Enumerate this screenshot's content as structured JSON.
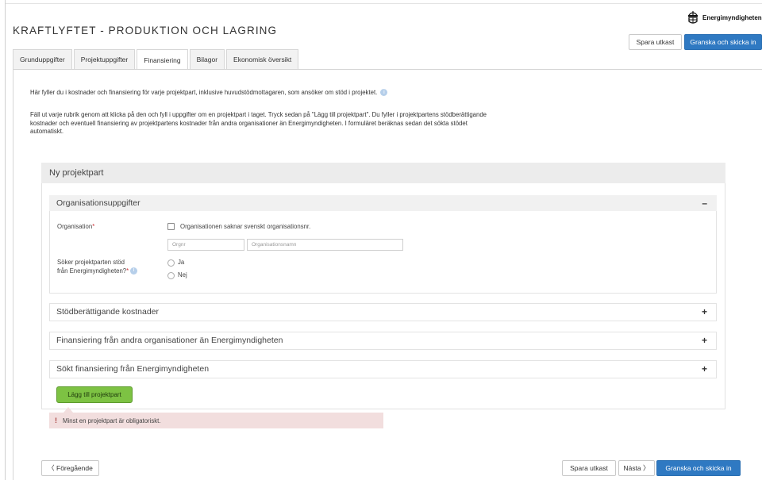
{
  "app": {
    "title": "KRAFTLYFTET - PRODUKTION OCH LAGRING",
    "logo_text": "Energimyndigheten"
  },
  "header_actions": {
    "save_draft": "Spara utkast",
    "review_submit": "Granska och skicka in"
  },
  "tabs": [
    {
      "label": "Grunduppgifter",
      "active": false
    },
    {
      "label": "Projektuppgifter",
      "active": false
    },
    {
      "label": "Finansiering",
      "active": true
    },
    {
      "label": "Bilagor",
      "active": false
    },
    {
      "label": "Ekonomisk översikt",
      "active": false
    }
  ],
  "intro": {
    "line1": "Här fyller du i kostnader och finansiering för varje projektpart, inklusive huvudstödmottagaren, som ansöker om stöd i projektet.",
    "line2": "Fäll ut varje rubrik genom att klicka på den och fyll i uppgifter om en projektpart i taget. Tryck sedan på \"Lägg till projektpart\". Du fyller i projektpartens stödberättigande kostnader och eventuell finansiering av projektpartens kostnader från andra organisationer än Energimyndigheten. I formuläret beräknas sedan det sökta stödet automatiskt."
  },
  "panel": {
    "title": "Ny projektpart",
    "org_section": {
      "title": "Organisationsuppgifter",
      "toggle": "–",
      "org_label": "Organisation",
      "required_mark": "*",
      "no_orgnr_checkbox": "Organisationen saknar svenskt organisationsnr.",
      "orgnr_placeholder": "Orgnr",
      "orgname_placeholder": "Organisationsnamn",
      "seeks_support_label_1": "Söker projektparten stöd",
      "seeks_support_label_2": "från Energimyndigheten?",
      "radio_yes": "Ja",
      "radio_no": "Nej"
    },
    "sections": [
      {
        "title": "Stödberättigande kostnader",
        "toggle": "+"
      },
      {
        "title": "Finansiering från andra organisationer än Energimyndigheten",
        "toggle": "+"
      },
      {
        "title": "Sökt finansiering från Energimyndigheten",
        "toggle": "+"
      }
    ],
    "add_button": "Lägg till projektpart"
  },
  "error": {
    "icon": "!",
    "message": "Minst en projektpart är obligatoriskt."
  },
  "footer": {
    "previous": "〈 Föregående",
    "save_draft": "Spara utkast",
    "next": "Nästa 〉",
    "review_submit": "Granska och skicka in"
  },
  "colors": {
    "primary": "#2f79c2",
    "add_button": "#7dc243",
    "error_bg": "#f2dede",
    "required": "#d0343a"
  },
  "icons": [
    "info-icon",
    "crown-logo-icon",
    "checkbox-icon",
    "radio-icon"
  ]
}
